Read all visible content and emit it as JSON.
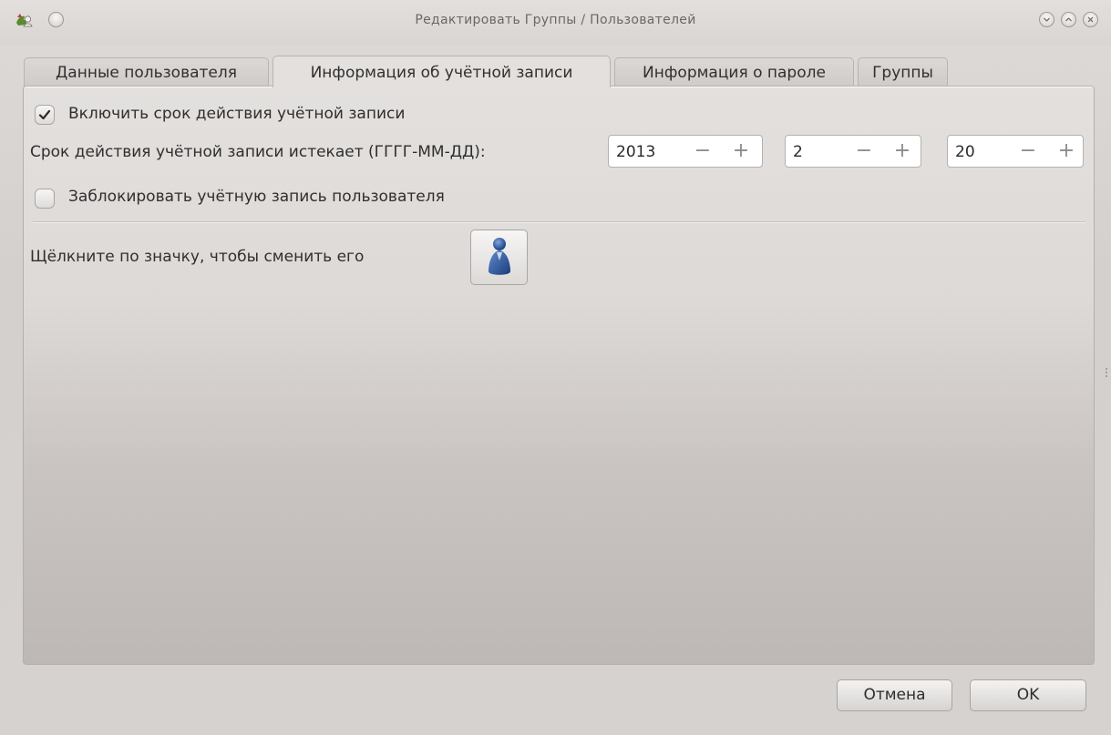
{
  "window": {
    "title": "Редактировать Группы / Пользователей",
    "icons": [
      "app-icon",
      "menu-circle-icon",
      "minimize-icon",
      "maximize-icon",
      "close-icon"
    ]
  },
  "tabs": [
    {
      "label": "Данные пользователя",
      "active": false
    },
    {
      "label": "Информация об учётной записи",
      "active": true
    },
    {
      "label": "Информация о пароле",
      "active": false
    },
    {
      "label": "Группы",
      "active": false
    }
  ],
  "account": {
    "enable_expiration_label": "Включить срок действия учётной записи",
    "enable_expiration_checked": true,
    "expires_label": "Срок действия учётной записи истекает (ГГГГ-ММ-ДД):",
    "year": "2013",
    "month": "2",
    "day": "20",
    "minus_symbol": "−",
    "plus_symbol": "+",
    "lock_label": "Заблокировать учётную запись пользователя",
    "lock_checked": false,
    "icon_hint": "Щёлкните по значку, чтобы сменить его",
    "user_icon": "user-avatar-icon"
  },
  "buttons": {
    "cancel": "Отмена",
    "ok": "OK"
  },
  "colors": {
    "background": "#d6d2d0",
    "panel": "#e3e0de",
    "avatar_blue": "#2e5aa0"
  }
}
